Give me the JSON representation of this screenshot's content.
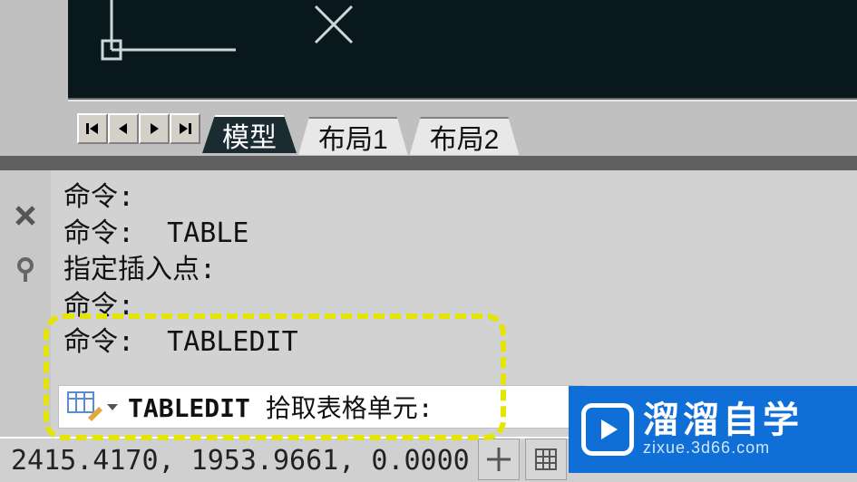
{
  "tabs": {
    "model": "模型",
    "layout1": "布局1",
    "layout2": "布局2"
  },
  "history": {
    "l1": "命令:",
    "l2": "命令:  TABLE",
    "l3": "指定插入点:",
    "l4": "命令:",
    "l5": "命令:  TABLEDIT"
  },
  "input": {
    "cmd": "TABLEDIT",
    "prompt": " 拾取表格单元:"
  },
  "status": {
    "coords": "2415.4170, 1953.9661, 0.0000"
  },
  "watermark": {
    "title": "溜溜自学",
    "sub": "zixue.3d66.com"
  }
}
